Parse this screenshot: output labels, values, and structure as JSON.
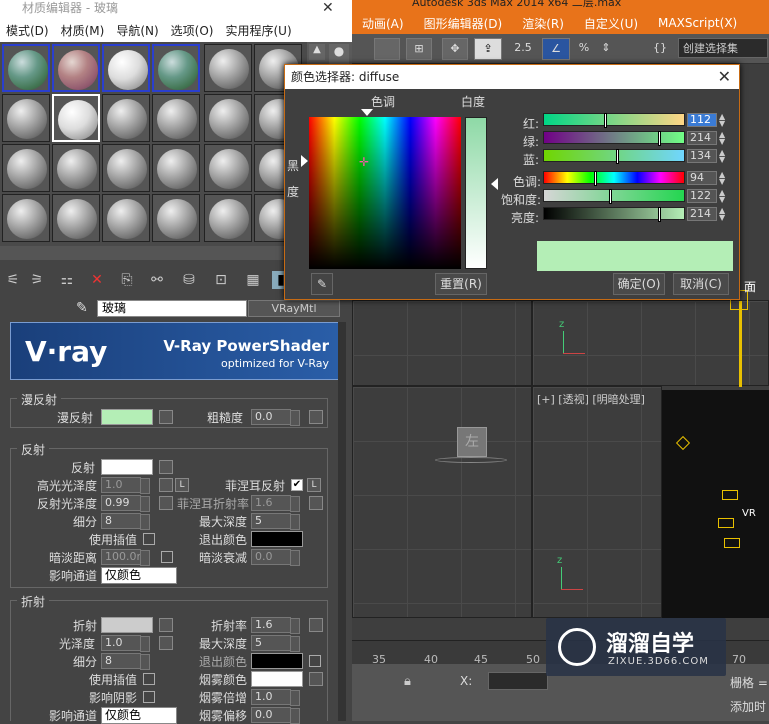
{
  "max": {
    "title": "Autodesk 3ds Max  2014 x64    二层.max",
    "menu": [
      "动画(A)",
      "图形编辑器(D)",
      "渲染(R)",
      "自定义(U)",
      "MAXScript(X)"
    ],
    "selection_set": "创建选择集",
    "snap_value": "2.5",
    "viewport_persp_label": "[+] [透视] [明暗处理]",
    "timeline_ticks": [
      "35",
      "40",
      "45",
      "50",
      "55",
      "60",
      "65",
      "70"
    ],
    "grid_label": "栅格 =",
    "add_time_label": "添加时",
    "coord_x_label": "X:",
    "left_view_label": "左",
    "vray_light_label": "VR",
    "surface_label": "面"
  },
  "material_editor": {
    "title": "材质编辑器 - 玻璃",
    "menu": [
      "模式(D)",
      "材质(M)",
      "导航(N)",
      "选项(O)",
      "实用程序(U)"
    ],
    "material_name": "玻璃",
    "material_type": "VRayMtl",
    "banner": {
      "logo": "V·ray",
      "title": "V-Ray PowerShader",
      "subtitle": "optimized for V-Ray"
    },
    "diffuse": {
      "group": "漫反射",
      "diffuse_label": "漫反射",
      "roughness_label": "粗糙度",
      "roughness": "0.0",
      "diffuse_color": "#b4eeb6"
    },
    "reflection": {
      "group": "反射",
      "reflect_label": "反射",
      "hilight_gloss_label": "高光光泽度",
      "hilight_gloss": "1.0",
      "fresnel_label": "菲涅耳反射",
      "refl_gloss_label": "反射光泽度",
      "refl_gloss": "0.99",
      "fresnel_ior_label": "菲涅耳折射率",
      "fresnel_ior": "1.6",
      "subdivs_label": "细分",
      "subdivs": "8",
      "max_depth_label": "最大深度",
      "max_depth": "5",
      "use_interp_label": "使用插值",
      "exit_color_label": "退出颜色",
      "dim_dist_label": "暗淡距离",
      "dim_dist": "100.0n",
      "dim_falloff_label": "暗淡衰减",
      "dim_falloff": "0.0",
      "affect_channels_label": "影响通道",
      "affect_channels": "仅颜色",
      "lock_label": "L"
    },
    "refraction": {
      "group": "折射",
      "refract_label": "折射",
      "ior_label": "折射率",
      "ior": "1.6",
      "gloss_label": "光泽度",
      "gloss": "1.0",
      "max_depth_label": "最大深度",
      "max_depth": "5",
      "subdivs_label": "细分",
      "subdivs": "8",
      "exit_color_label": "退出颜色",
      "use_interp_label": "使用插值",
      "fog_color_label": "烟雾颜色",
      "affect_shadows_label": "影响阴影",
      "fog_mult_label": "烟雾倍增",
      "fog_mult": "1.0",
      "affect_channels_label": "影响通道",
      "affect_channels": "仅颜色",
      "fog_bias_label": "烟雾偏移",
      "fog_bias": "0.0"
    }
  },
  "color_picker": {
    "title": "颜色选择器: diffuse",
    "hue_label": "色调",
    "whiteness_label": "白度",
    "black_label": "黑",
    "degree_label": "度",
    "red_label": "红:",
    "red": "112",
    "green_label": "绿:",
    "green": "214",
    "blue_label": "蓝:",
    "blue": "134",
    "hue2_label": "色调:",
    "hue": "94",
    "sat_label": "饱和度:",
    "sat": "122",
    "val_label": "亮度:",
    "val": "214",
    "reset_label": "重置(R)",
    "ok_label": "确定(O)",
    "cancel_label": "取消(C)",
    "color_hex": "#b4eeb6",
    "red_fraction": 0.44,
    "green_fraction": 0.84,
    "blue_fraction": 0.53,
    "hue_fraction": 0.37,
    "sat_fraction": 0.48,
    "val_fraction": 0.84
  },
  "watermark": {
    "title": "溜溜自学",
    "url": "ZIXUE.3D66.COM"
  }
}
